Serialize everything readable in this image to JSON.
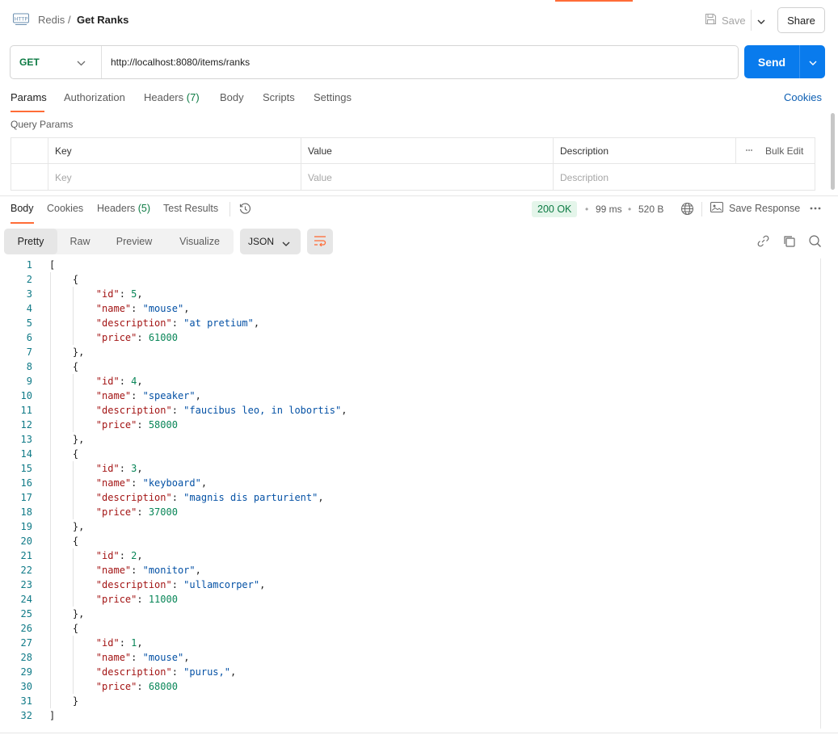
{
  "header": {
    "breadcrumb_parent": "Redis",
    "breadcrumb_separator": "/",
    "breadcrumb_current": "Get Ranks",
    "save_label": "Save",
    "share_label": "Share"
  },
  "request": {
    "method": "GET",
    "url": "http://localhost:8080/items/ranks",
    "send_label": "Send"
  },
  "request_tabs": {
    "params": "Params",
    "authorization": "Authorization",
    "headers": "Headers",
    "headers_count": "(7)",
    "body": "Body",
    "scripts": "Scripts",
    "settings": "Settings",
    "active": "Params"
  },
  "cookies_link": "Cookies",
  "query_params": {
    "title": "Query Params",
    "columns": [
      "Key",
      "Value",
      "Description"
    ],
    "bulk_edit": "Bulk Edit",
    "placeholders": [
      "Key",
      "Value",
      "Description"
    ]
  },
  "response_tabs": {
    "body": "Body",
    "cookies": "Cookies",
    "headers": "Headers",
    "headers_count": "(5)",
    "test_results": "Test Results",
    "active": "Body"
  },
  "response_meta": {
    "status": "200 OK",
    "time": "99 ms",
    "size": "520 B",
    "save_response": "Save Response"
  },
  "view_modes": {
    "pretty": "Pretty",
    "raw": "Raw",
    "preview": "Preview",
    "visualize": "Visualize",
    "active": "Pretty"
  },
  "format": "JSON",
  "response_items": [
    {
      "id": 5,
      "name": "mouse",
      "description": "at pretium",
      "price": 61000
    },
    {
      "id": 4,
      "name": "speaker",
      "description": "faucibus leo, in lobortis",
      "price": 58000
    },
    {
      "id": 3,
      "name": "keyboard",
      "description": "magnis dis parturient",
      "price": 37000
    },
    {
      "id": 2,
      "name": "monitor",
      "description": "ullamcorper",
      "price": 11000
    },
    {
      "id": 1,
      "name": "mouse",
      "description": "purus,",
      "price": 68000
    }
  ],
  "colors": {
    "accent": "#ff6c37",
    "send": "#097bed",
    "method_get": "#0c7a43",
    "status_ok": "#0c7a43",
    "json_key": "#a31515",
    "json_string": "#0451a5",
    "json_number": "#098658"
  },
  "icons": {
    "http": "http-file-icon",
    "save": "floppy-disk-icon",
    "history": "history-icon",
    "globe": "globe-icon",
    "save_response": "save-response-icon",
    "more": "more-horizontal-icon",
    "wrap": "wrap-lines-icon",
    "link": "link-icon",
    "copy": "copy-icon",
    "search": "search-icon"
  }
}
